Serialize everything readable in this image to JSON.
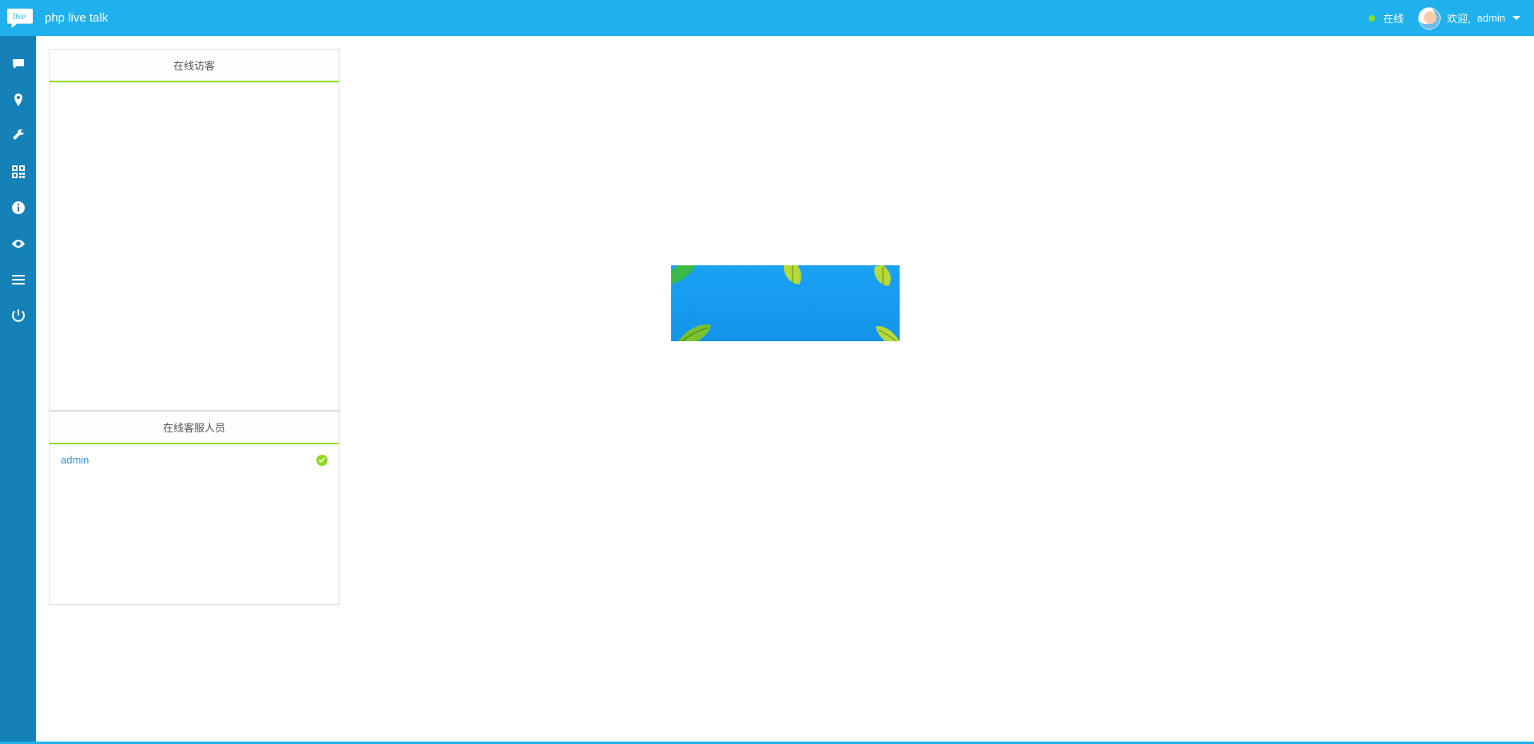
{
  "header": {
    "brand": "php live talk",
    "status_label": "在线",
    "welcome_prefix": "欢迎,",
    "user_name": "admin"
  },
  "sidebar": {
    "items": [
      {
        "id": "chat",
        "icon": "chat-icon"
      },
      {
        "id": "location",
        "icon": "pin-icon"
      },
      {
        "id": "settings",
        "icon": "wrench-icon"
      },
      {
        "id": "qrcode",
        "icon": "qrcode-icon"
      },
      {
        "id": "info",
        "icon": "info-icon"
      },
      {
        "id": "views",
        "icon": "eye-icon"
      },
      {
        "id": "reports",
        "icon": "list-icon"
      },
      {
        "id": "logout",
        "icon": "power-icon"
      }
    ],
    "active": "chat"
  },
  "panels": {
    "visitors_title": "在线访客",
    "agents_title": "在线客服人员",
    "agents": [
      {
        "name": "admin",
        "online": true
      }
    ]
  },
  "colors": {
    "brand_blue": "#1eb1ed",
    "rail_blue": "#1481b8",
    "accent_green": "#8edc1c"
  }
}
